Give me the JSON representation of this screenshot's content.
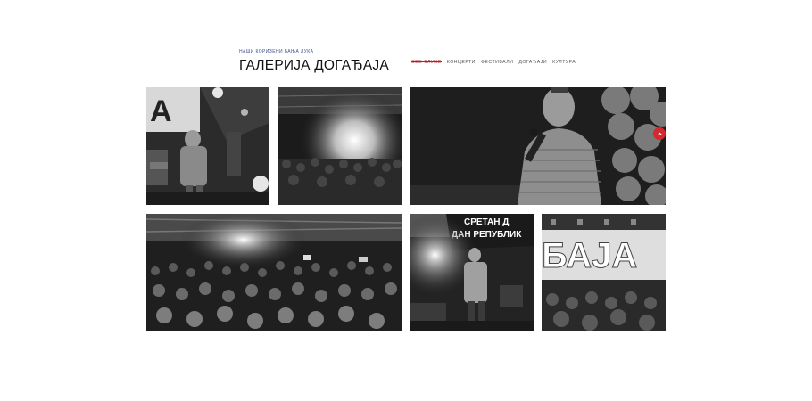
{
  "header": {
    "eyebrow": "НАШИ КОРИЗЕНИ БАЊА ЛУКА",
    "title": "ГАЛЕРИЈА ДОГАЂАЈА"
  },
  "nav": {
    "items": [
      "СВЕ СЛИКЕ",
      "КОНЦЕРТИ",
      "ФЕСТИВАЛИ",
      "ДОГАЂАЈИ",
      "КУЛТУРА"
    ],
    "active_index": 0
  },
  "gallery": {
    "photos": [
      {
        "subject": "singer-on-stage"
      },
      {
        "subject": "concert-crowd-stage"
      },
      {
        "subject": "singer-closeup-balloons"
      },
      {
        "subject": "arena-crowd"
      },
      {
        "subject": "singer-stage-banner",
        "banner_text": "СРЕТАН Д ДАН РЕПУБЛИК"
      },
      {
        "subject": "banja-sign",
        "sign_text": "БАЈА"
      }
    ]
  },
  "icons": {
    "scroll_top": "arrow-up-icon"
  },
  "colors": {
    "accent": "#b51f24",
    "eyebrow": "#3b4f8f",
    "fab": "#d22a2f"
  }
}
